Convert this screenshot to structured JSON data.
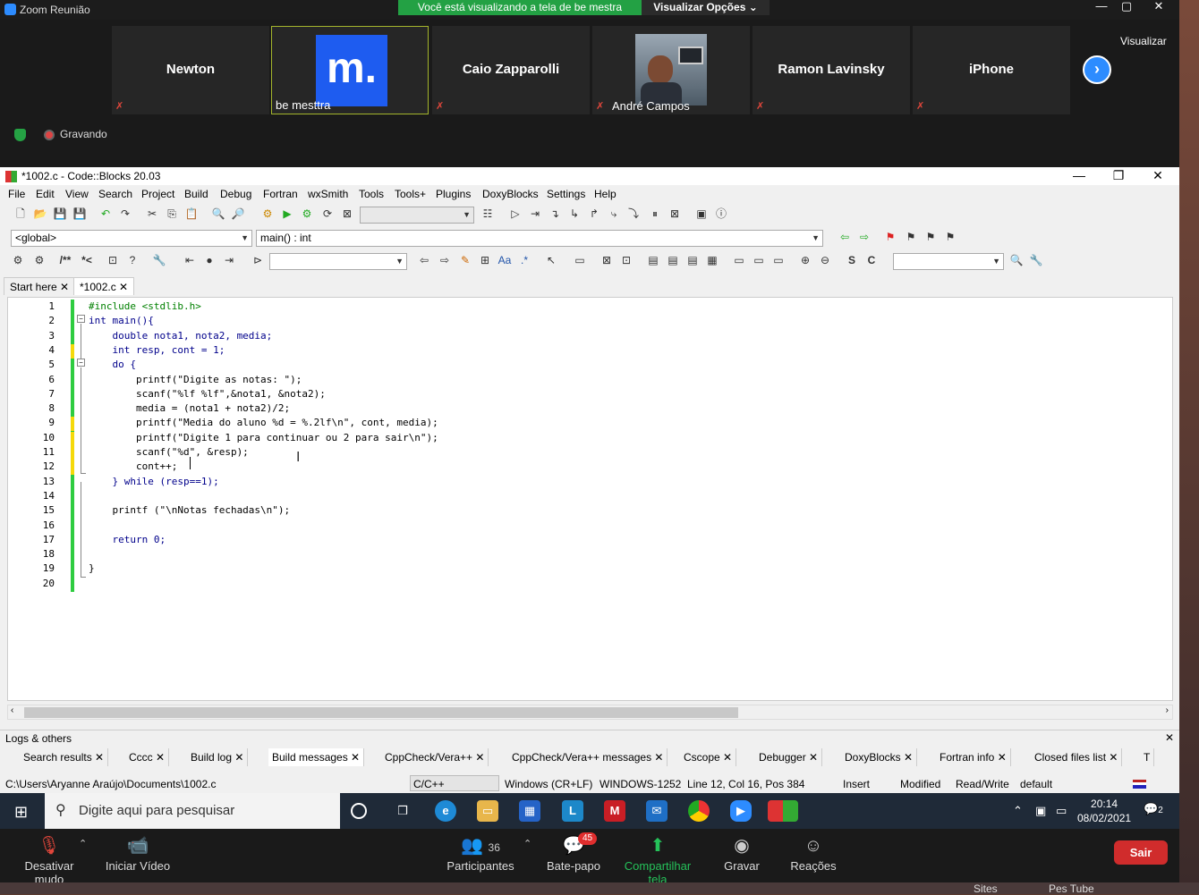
{
  "zoom": {
    "window_title": "Zoom Reunião",
    "share_banner": "Você está visualizando a tela de be mestra",
    "view_options": "Visualizar Opções",
    "visualizar": "Visualizar",
    "recording": "Gravando",
    "participants": [
      {
        "name": "Newton"
      },
      {
        "name": "be mesttra",
        "logo_text": "m."
      },
      {
        "name": "Caio Zapparolli"
      },
      {
        "name": "André Campos"
      },
      {
        "name": "Ramon Lavinsky"
      },
      {
        "name": "iPhone"
      }
    ],
    "bottom": {
      "mute": "Desativar mudo",
      "video": "Iniciar Vídeo",
      "participants": "Participantes",
      "participants_count": "36",
      "chat": "Bate-papo",
      "chat_badge": "45",
      "share": "Compartilhar tela",
      "record": "Gravar",
      "reactions": "Reações",
      "leave": "Sair"
    }
  },
  "codeblocks": {
    "title": "*1002.c - Code::Blocks 20.03",
    "menu": [
      "File",
      "Edit",
      "View",
      "Search",
      "Project",
      "Build",
      "Debug",
      "Fortran",
      "wxSmith",
      "Tools",
      "Tools+",
      "Plugins",
      "DoxyBlocks",
      "Settings",
      "Help"
    ],
    "scope_combo": "<global>",
    "symbol_combo": "main() : int",
    "tabs": [
      "Start here",
      "*1002.c"
    ],
    "line_numbers": [
      "1",
      "2",
      "3",
      "4",
      "5",
      "6",
      "7",
      "8",
      "9",
      "10",
      "11",
      "12",
      "13",
      "14",
      "15",
      "16",
      "17",
      "18",
      "19",
      "20"
    ],
    "code_lines": [
      "#include <stdlib.h>",
      "int main(){",
      "    double nota1, nota2, media;",
      "    int resp, cont = 1;",
      "    do {",
      "        printf(\"Digite as notas: \");",
      "        scanf(\"%lf %lf\",&nota1, &nota2);",
      "        media = (nota1 + nota2)/2;",
      "        printf(\"Media do aluno %d = %.2lf\\n\", cont, media);",
      "        printf(\"Digite 1 para continuar ou 2 para sair\\n\");",
      "        scanf(\"%d\", &resp);",
      "        cont++;",
      "    } while (resp==1);",
      "",
      "    printf (\"\\nNotas fechadas\\n\");",
      "",
      "    return 0;",
      "",
      "}",
      ""
    ],
    "logs_title": "Logs & others",
    "log_tabs": [
      "Search results",
      "Cccc",
      "Build log",
      "Build messages",
      "CppCheck/Vera++",
      "CppCheck/Vera++ messages",
      "Cscope",
      "Debugger",
      "DoxyBlocks",
      "Fortran info",
      "Closed files list",
      "T"
    ],
    "status": {
      "path": "C:\\Users\\Aryanne Araújo\\Documents\\1002.c",
      "lang": "C/C++",
      "eol": "Windows (CR+LF)",
      "encoding": "WINDOWS-1252",
      "position": "Line 12, Col 16, Pos 384",
      "mode": "Insert",
      "modified": "Modified",
      "access": "Read/Write",
      "profile": "default"
    }
  },
  "taskbar": {
    "search_placeholder": "Digite aqui para pesquisar",
    "time": "20:14",
    "date": "08/02/2021",
    "notif_count": "2"
  },
  "background": {
    "sites": "Sites",
    "pes_tube": "Pes Tube"
  }
}
